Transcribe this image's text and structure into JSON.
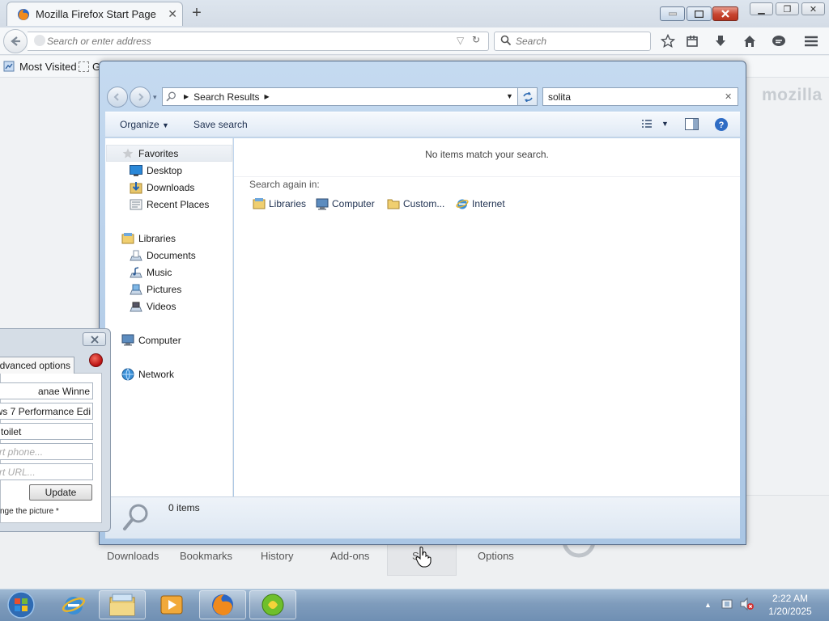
{
  "browser": {
    "tab_title": "Mozilla Firefox Start Page",
    "new_tab": "+",
    "url_placeholder": "Search or enter address",
    "search_placeholder": "Search",
    "bookmarks_toolbar": {
      "most_visited": "Most Visited",
      "getting_started_fragment": "G"
    },
    "page_logo": "mozilla",
    "launcher": [
      "Downloads",
      "Bookmarks",
      "History",
      "Add-ons",
      "Sync",
      "Options"
    ],
    "launcher_sync_visible": "S"
  },
  "explorer": {
    "breadcrumb": "Search Results",
    "search_value": "solita",
    "toolbar": {
      "organize": "Organize",
      "save_search": "Save search"
    },
    "nav": {
      "favorites": "Favorites",
      "desktop": "Desktop",
      "downloads": "Downloads",
      "recent_places": "Recent Places",
      "libraries": "Libraries",
      "documents": "Documents",
      "music": "Music",
      "pictures": "Pictures",
      "videos": "Videos",
      "computer": "Computer",
      "network": "Network"
    },
    "no_items": "No items match your search.",
    "search_again_label": "Search again in:",
    "search_again": [
      "Libraries",
      "Computer",
      "Custom...",
      "Internet"
    ],
    "item_count": "0 items"
  },
  "dialog": {
    "tab_label": "dvanced options",
    "fields": [
      "anae Winne",
      "ows 7 Performance Edi",
      "toilet"
    ],
    "placeholders": [
      "rt phone...",
      "rt URL..."
    ],
    "update_button": "Update",
    "note": "nge the picture *"
  },
  "taskbar": {
    "apps": [
      "internet-explorer",
      "windows-explorer",
      "media-player",
      "firefox",
      "game-app"
    ],
    "time": "2:22 AM",
    "date": "1/20/2025"
  },
  "colors": {
    "explorer_frame": "#b4cde8",
    "taskbar": "#7f9cbc",
    "close_red": "#c7442f"
  }
}
